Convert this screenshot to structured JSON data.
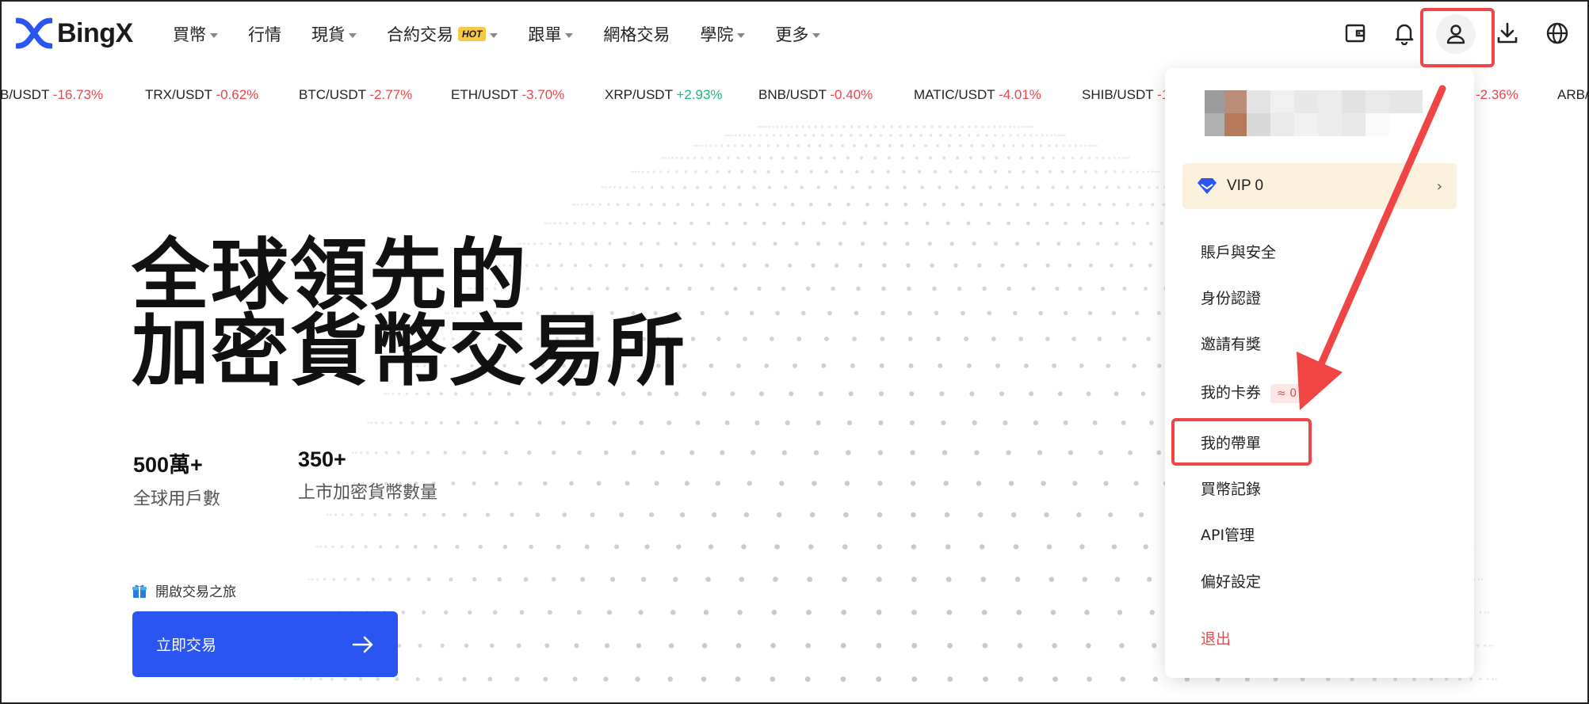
{
  "brand": {
    "name": "BingX"
  },
  "nav": {
    "items": [
      {
        "label": "買幣",
        "dropdown": true,
        "hot": false
      },
      {
        "label": "行情",
        "dropdown": false,
        "hot": false
      },
      {
        "label": "現貨",
        "dropdown": true,
        "hot": false
      },
      {
        "label": "合約交易",
        "dropdown": true,
        "hot": true
      },
      {
        "label": "跟單",
        "dropdown": true,
        "hot": false
      },
      {
        "label": "網格交易",
        "dropdown": false,
        "hot": false
      },
      {
        "label": "學院",
        "dropdown": true,
        "hot": false
      },
      {
        "label": "更多",
        "dropdown": true,
        "hot": false
      }
    ],
    "hot_badge": "HOT"
  },
  "header_icons": [
    "wallet-icon",
    "bell-icon",
    "user-icon",
    "download-icon",
    "globe-icon"
  ],
  "ticker": [
    {
      "pair": "B/USDT",
      "change": "-16.73%",
      "dir": "neg"
    },
    {
      "pair": "TRX/USDT",
      "change": "-0.62%",
      "dir": "neg"
    },
    {
      "pair": "BTC/USDT",
      "change": "-2.77%",
      "dir": "neg"
    },
    {
      "pair": "ETH/USDT",
      "change": "-3.70%",
      "dir": "neg"
    },
    {
      "pair": "XRP/USDT",
      "change": "+2.93%",
      "dir": "pos"
    },
    {
      "pair": "BNB/USDT",
      "change": "-0.40%",
      "dir": "neg"
    },
    {
      "pair": "MATIC/USDT",
      "change": "-4.01%",
      "dir": "neg"
    },
    {
      "pair": "SHIB/USDT",
      "change": "-1",
      "dir": "neg"
    },
    {
      "pair": "",
      "change": "-2.36%",
      "dir": "neg"
    },
    {
      "pair": "ARB/",
      "change": "",
      "dir": "neg"
    }
  ],
  "hero": {
    "title_line1": "全球領先的",
    "title_line2": "加密貨幣交易所",
    "stats": [
      {
        "value": "500萬+",
        "label": "全球用戶數"
      },
      {
        "value": "350+",
        "label": "上市加密貨幣數量"
      }
    ],
    "journey_label": "開啟交易之旅",
    "cta_label": "立即交易"
  },
  "user_menu": {
    "vip_label": "VIP 0",
    "items": [
      {
        "label": "賬戶與安全"
      },
      {
        "label": "身份認證"
      },
      {
        "label": "邀請有獎"
      },
      {
        "label": "我的卡券",
        "badge": "≈ 0"
      },
      {
        "label": "我的帶單",
        "highlighted": true
      },
      {
        "label": "買幣記錄"
      },
      {
        "label": "API管理"
      },
      {
        "label": "偏好設定"
      }
    ],
    "logout_label": "退出"
  },
  "colors": {
    "accent": "#2a55f0",
    "negative": "#e5484d",
    "positive": "#21b57a",
    "annotation": "#f04545",
    "vip_bg": "#fbf1dd",
    "hot_bg": "#f5c944"
  }
}
